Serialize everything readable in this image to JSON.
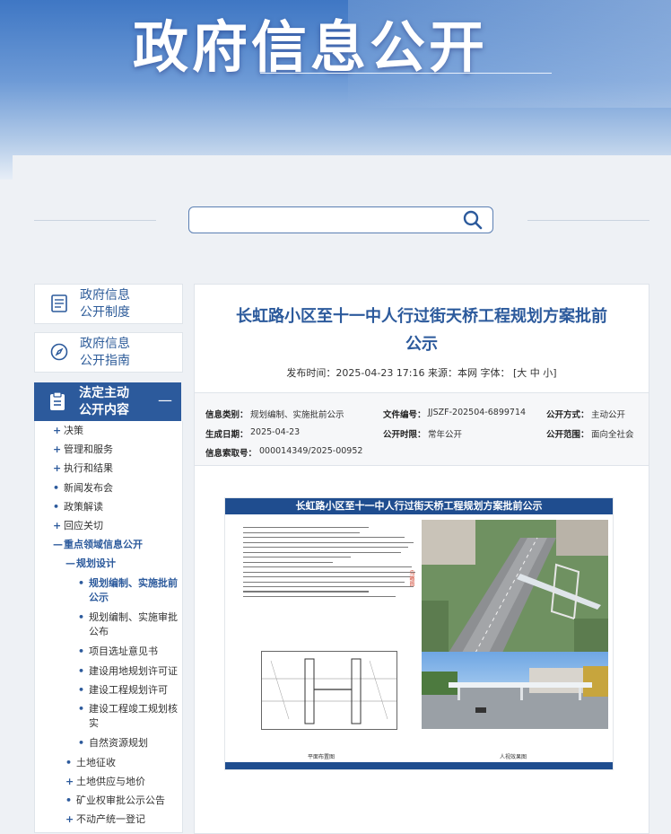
{
  "banner": {
    "title": "政府信息公开"
  },
  "search": {
    "placeholder": ""
  },
  "sidebar": {
    "cards": [
      {
        "label_line1": "政府信息",
        "label_line2": "公开制度"
      },
      {
        "label_line1": "政府信息",
        "label_line2": "公开指南"
      }
    ],
    "active": {
      "label_line1": "法定主动",
      "label_line2": "公开内容",
      "toggle": "—"
    },
    "tree": [
      {
        "marker": "+",
        "label": "决策"
      },
      {
        "marker": "+",
        "label": "管理和服务"
      },
      {
        "marker": "+",
        "label": "执行和结果"
      },
      {
        "marker": "•",
        "label": "新闻发布会"
      },
      {
        "marker": "•",
        "label": "政策解读"
      },
      {
        "marker": "+",
        "label": "回应关切"
      },
      {
        "marker": "—",
        "label": "重点领域信息公开"
      },
      {
        "marker": "—",
        "label": "规划设计"
      },
      {
        "marker": "•",
        "label": "规划编制、实施批前"
      },
      {
        "marker": "",
        "label": "公示"
      },
      {
        "marker": "•",
        "label": "规划编制、实施审批"
      },
      {
        "marker": "",
        "label": "公布"
      },
      {
        "marker": "•",
        "label": "项目选址意见书"
      },
      {
        "marker": "•",
        "label": "建设用地规划许可证"
      },
      {
        "marker": "•",
        "label": "建设工程规划许可"
      },
      {
        "marker": "•",
        "label": "建设工程竣工规划核"
      },
      {
        "marker": "",
        "label": "实"
      },
      {
        "marker": "•",
        "label": "自然资源规划"
      },
      {
        "marker": "•",
        "label": "土地征收"
      },
      {
        "marker": "+",
        "label": "土地供应与地价"
      },
      {
        "marker": "•",
        "label": "矿业权审批公示公告"
      },
      {
        "marker": "+",
        "label": "不动产统一登记"
      }
    ]
  },
  "article": {
    "title_line1": "长虹路小区至十一中人行过街天桥工程规划方案批前",
    "title_line2": "公示",
    "meta": "发布时间：2025-04-23 17:16   来源：本网   字体：   [大 中 小]",
    "info": {
      "category_k": "信息类别：",
      "category_v": "规划编制、实施批前公示",
      "docno_k": "文件编号：",
      "docno_v": "JJSZF-202504-6899714",
      "method_k": "公开方式：",
      "method_v": "主动公开",
      "date_k": "生成日期：",
      "date_v": "2025-04-23",
      "period_k": "公开时限：",
      "period_v": "常年公开",
      "scope_k": "公开范围：",
      "scope_v": "面向全社会",
      "index_k": "信息索取号：",
      "index_v": "000014349/2025-00952"
    },
    "poster": {
      "heading": "长虹路小区至十一中人行过街天桥工程规划方案批前公示",
      "side_label": "鸟瞰图",
      "plan_caption": "平面布置图",
      "render_caption": "人视效果图"
    }
  },
  "colors": {
    "brand": "#2c5a9c",
    "banner_top": "#3f77c4"
  }
}
